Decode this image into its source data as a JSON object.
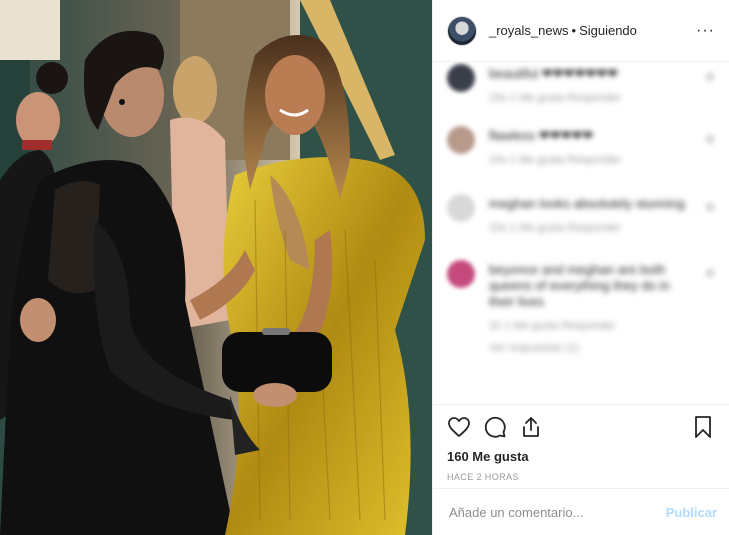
{
  "header": {
    "username": "_royals_news",
    "separator": "•",
    "follow_status": "Siguiendo",
    "more_icon": "more-icon",
    "more_glyph": "···"
  },
  "comments": [
    {
      "avatar_color": "#3a3f4a",
      "text": "beautiful ❤❤❤❤❤❤❤",
      "meta": "25s    1 Me gusta    Responder"
    },
    {
      "avatar_color": "#b79a8a",
      "text": "flawless ❤❤❤❤❤",
      "meta": "15s    1 Me gusta    Responder"
    },
    {
      "avatar_color": "#d9d9d9",
      "text": "meghan looks absolutely stunning",
      "meta": "15s    1 Me gusta    Responder"
    },
    {
      "avatar_color": "#c64a7e",
      "text": "beyonce and meghan are both queens of everything they do in their lives",
      "meta": "1h    1 Me gusta    Responder",
      "extra": "Ver respuestas (1)"
    }
  ],
  "actions": {
    "like_icon": "heart-icon",
    "comment_icon": "comment-icon",
    "share_icon": "share-icon",
    "save_icon": "bookmark-icon",
    "likes": "160 Me gusta",
    "time": "HACE 2 HORAS"
  },
  "add_comment": {
    "placeholder": "Añade un comentario...",
    "publish": "Publicar"
  },
  "colors": {
    "accent": "#0095f6",
    "publish_disabled": "#b3dbff",
    "gown": "#c9a51a",
    "dress": "#111111"
  }
}
